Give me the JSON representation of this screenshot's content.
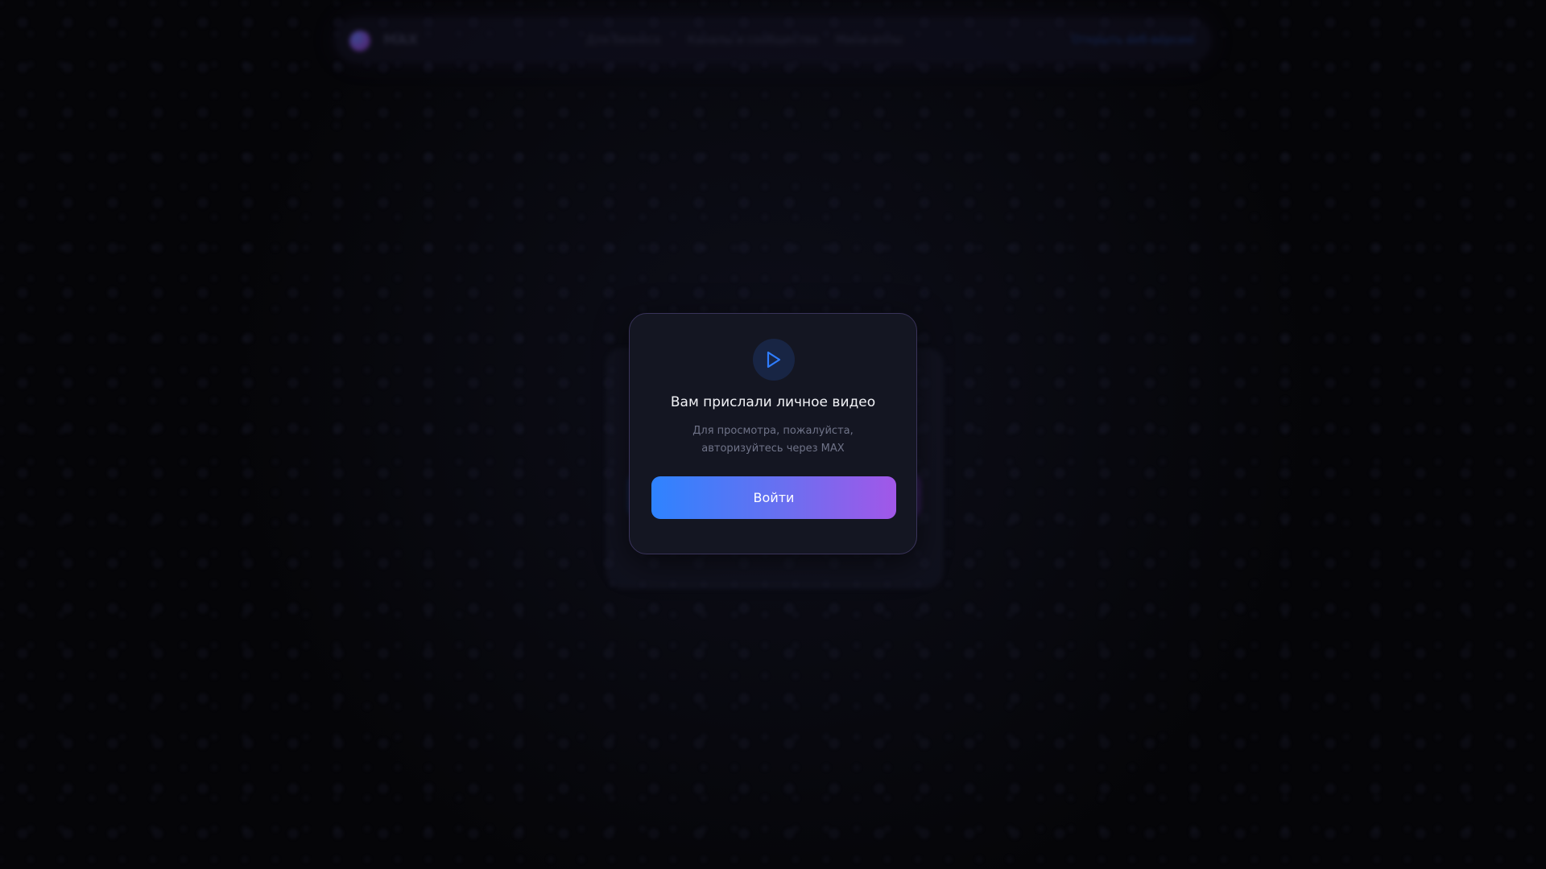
{
  "navbar": {
    "brand": "MAX",
    "links": [
      "Для бизнеса",
      "Каналы и сообщества",
      "Мини-аппы"
    ],
    "cta": "Открыть веб-версию"
  },
  "modal": {
    "icon": "play-icon",
    "title": "Вам прислали личное видео",
    "subtitle": "Для просмотра, пожалуйста, авторизуйтесь через MAX",
    "button_label": "Войти"
  },
  "colors": {
    "background": "#050508",
    "modal_bg": "#141622",
    "modal_border": "#39335a",
    "accent_blue": "#2e83ff",
    "accent_purple": "#a257e8",
    "icon_blue": "#2f7dff"
  }
}
